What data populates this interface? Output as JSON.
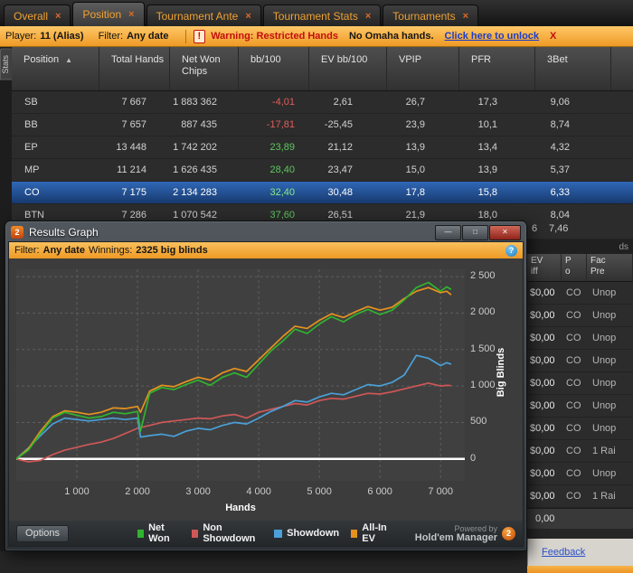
{
  "icons": {
    "tab_close": "×",
    "sort_asc": "▲",
    "minimize": "—",
    "maximize": "□",
    "close": "✕",
    "info": "?",
    "warning": "!",
    "window_badge": "2",
    "brand_badge": "2"
  },
  "tabs": [
    {
      "label": "Overall",
      "active": false
    },
    {
      "label": "Position",
      "active": true
    },
    {
      "label": "Tournament Ante",
      "active": false
    },
    {
      "label": "Tournament Stats",
      "active": false
    },
    {
      "label": "Tournaments",
      "active": false
    }
  ],
  "filter_bar": {
    "player_label": "Player:",
    "player_value": "11 (Alias)",
    "filter_label": "Filter:",
    "filter_value": "Any date",
    "warning_text": "Warning: Restricted Hands",
    "warning_detail": "No Omaha hands.",
    "unlock_link": "Click here to unlock",
    "close_label": "X"
  },
  "stats_tab_label": "Stats",
  "table": {
    "columns": [
      "Position",
      "Total Hands",
      "Net Won Chips",
      "bb/100",
      "EV bb/100",
      "VPIP",
      "PFR",
      "3Bet"
    ],
    "sort_column": 0,
    "selected": "CO",
    "rows": [
      {
        "position": "SB",
        "values": [
          "7 667",
          "1 883 362",
          "-4,01",
          "2,61",
          "26,7",
          "17,3",
          "9,06"
        ]
      },
      {
        "position": "BB",
        "values": [
          "7 657",
          "887 435",
          "-17,81",
          "-25,45",
          "23,9",
          "10,1",
          "8,74"
        ]
      },
      {
        "position": "EP",
        "values": [
          "13 448",
          "1 742 202",
          "23,89",
          "21,12",
          "13,9",
          "13,4",
          "4,32"
        ]
      },
      {
        "position": "MP",
        "values": [
          "11 214",
          "1 626 435",
          "28,40",
          "23,47",
          "15,0",
          "13,9",
          "5,37"
        ]
      },
      {
        "position": "CO",
        "values": [
          "7 175",
          "2 134 283",
          "32,40",
          "30,48",
          "17,8",
          "15,8",
          "6,33"
        ]
      },
      {
        "position": "BTN",
        "values": [
          "7 286",
          "1 070 542",
          "37,60",
          "26,51",
          "21,9",
          "18,0",
          "8,04"
        ]
      }
    ],
    "partial_row_fragments": [
      "6",
      "7,46"
    ]
  },
  "right_panel": {
    "corner_fragment": "ds",
    "column_headers": [
      {
        "line1": "EV",
        "line2": "iff"
      },
      {
        "line1": "P",
        "line2": "o"
      },
      {
        "line1": "Fac",
        "line2": "Pre"
      }
    ],
    "rows": [
      {
        "ev": "$0,00",
        "pos": "CO",
        "facing": "Unop"
      },
      {
        "ev": "$0,00",
        "pos": "CO",
        "facing": "Unop"
      },
      {
        "ev": "$0,00",
        "pos": "CO",
        "facing": "Unop"
      },
      {
        "ev": "$0,00",
        "pos": "CO",
        "facing": "Unop"
      },
      {
        "ev": "$0,00",
        "pos": "CO",
        "facing": "Unop"
      },
      {
        "ev": "$0,00",
        "pos": "CO",
        "facing": "Unop"
      },
      {
        "ev": "$0,00",
        "pos": "CO",
        "facing": "Unop"
      },
      {
        "ev": "$0,00",
        "pos": "CO",
        "facing": "1 Rai"
      },
      {
        "ev": "$0,00",
        "pos": "CO",
        "facing": "Unop"
      },
      {
        "ev": "$0,00",
        "pos": "CO",
        "facing": "1 Rai"
      }
    ],
    "total": "0,00"
  },
  "results_window": {
    "title": "Results Graph",
    "filter_label": "Filter:",
    "filter_value": "Any date",
    "winnings_label": "Winnings:",
    "winnings_value": "2325 big blinds",
    "options_button": "Options",
    "powered_by": "Powered by",
    "brand": "Hold'em Manager"
  },
  "status_bar": {
    "feedback_link": "Feedback"
  },
  "chart_data": {
    "type": "line",
    "title": "",
    "xlabel": "Hands",
    "ylabel": "Big Blinds",
    "xlim": [
      0,
      7400
    ],
    "ylim": [
      -300,
      2600
    ],
    "xticks": [
      1000,
      2000,
      3000,
      4000,
      5000,
      6000,
      7000
    ],
    "yticks": [
      0,
      500,
      1000,
      1500,
      2000,
      2500
    ],
    "grid": "dashed",
    "legend_position": "bottom",
    "zero_line": true,
    "x": [
      0,
      200,
      400,
      600,
      800,
      1000,
      1200,
      1400,
      1600,
      1800,
      2000,
      2050,
      2200,
      2400,
      2600,
      2800,
      3000,
      3200,
      3400,
      3600,
      3800,
      4000,
      4200,
      4400,
      4600,
      4800,
      5000,
      5200,
      5400,
      5600,
      5800,
      6000,
      6200,
      6400,
      6600,
      6800,
      7000,
      7100,
      7175
    ],
    "series": [
      {
        "name": "Net Won",
        "color": "#2fb52f",
        "values": [
          0,
          120,
          350,
          560,
          640,
          600,
          560,
          580,
          640,
          620,
          650,
          380,
          900,
          980,
          950,
          1020,
          1080,
          1010,
          1120,
          1180,
          1120,
          1300,
          1480,
          1620,
          1780,
          1720,
          1850,
          1950,
          1880,
          1980,
          2050,
          1980,
          2040,
          2180,
          2350,
          2420,
          2300,
          2360,
          2325
        ]
      },
      {
        "name": "Non Showdown",
        "color": "#d05757",
        "values": [
          0,
          -40,
          -20,
          60,
          120,
          160,
          200,
          230,
          280,
          350,
          420,
          430,
          460,
          500,
          520,
          540,
          560,
          550,
          590,
          610,
          560,
          640,
          680,
          720,
          760,
          740,
          800,
          830,
          820,
          860,
          900,
          890,
          920,
          960,
          1000,
          1040,
          1000,
          1010,
          1005
        ]
      },
      {
        "name": "Showdown",
        "color": "#4aa0d8",
        "values": [
          0,
          150,
          320,
          480,
          560,
          540,
          520,
          540,
          560,
          540,
          560,
          300,
          320,
          340,
          310,
          380,
          420,
          400,
          460,
          500,
          480,
          560,
          650,
          720,
          800,
          780,
          850,
          900,
          880,
          950,
          1020,
          1000,
          1050,
          1150,
          1420,
          1380,
          1280,
          1320,
          1300
        ]
      },
      {
        "name": "All-In EV",
        "color": "#e6921e",
        "values": [
          0,
          140,
          380,
          580,
          660,
          640,
          610,
          640,
          700,
          690,
          720,
          640,
          930,
          1010,
          990,
          1060,
          1120,
          1080,
          1180,
          1240,
          1200,
          1360,
          1520,
          1680,
          1820,
          1790,
          1900,
          1990,
          1940,
          2020,
          2090,
          2040,
          2080,
          2200,
          2300,
          2350,
          2280,
          2300,
          2250
        ]
      }
    ]
  }
}
